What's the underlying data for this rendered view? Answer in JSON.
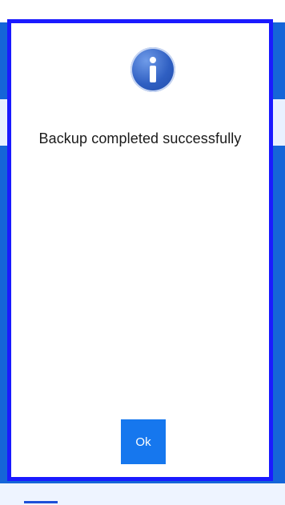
{
  "dialog": {
    "icon": "info-icon",
    "message": "Backup completed successfully",
    "ok_label": "Ok"
  },
  "colors": {
    "dialog_border": "#1a1aff",
    "ok_button": "#1677ee",
    "background_accent": "#1565d8"
  }
}
